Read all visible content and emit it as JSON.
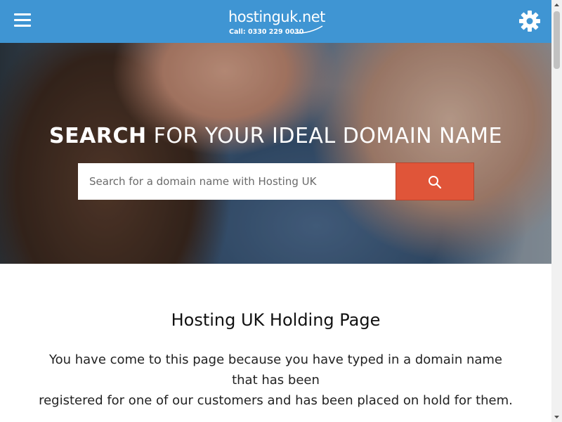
{
  "header": {
    "logo_text": "hostinguk.net",
    "logo_phone": "Call: 0330 229 0030",
    "menu_icon": "hamburger-icon",
    "settings_icon": "gear-icon"
  },
  "hero": {
    "title_bold": "SEARCH",
    "title_rest": " FOR YOUR IDEAL DOMAIN NAME",
    "search_placeholder": "Search for a domain name with Hosting UK",
    "search_icon": "search-icon"
  },
  "content": {
    "title": "Hosting UK Holding Page",
    "line1": "You have come to this page because you have typed in a domain name that has been",
    "line2": "registered for one of our customers and has been placed on hold for them."
  },
  "colors": {
    "header_bg": "#3f95d3",
    "search_button_bg": "#e05539",
    "text": "#222222"
  }
}
